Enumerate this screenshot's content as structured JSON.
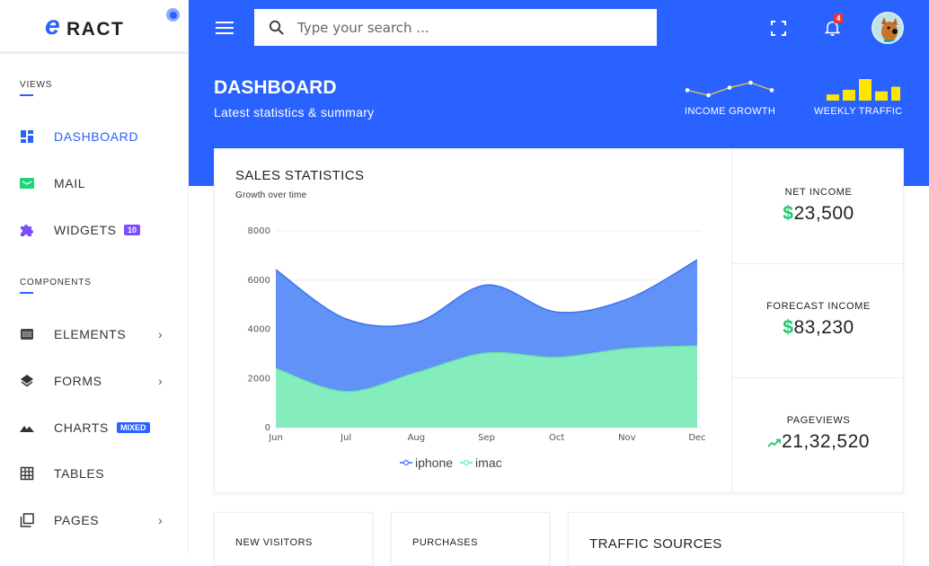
{
  "logo": {
    "mark": "e",
    "text": "RACT"
  },
  "sidebar": {
    "sections": [
      {
        "title": "VIEWS"
      },
      {
        "title": "COMPONENTS"
      }
    ],
    "items": [
      {
        "label": "DASHBOARD",
        "icon": "dashboard-icon",
        "active": true
      },
      {
        "label": "MAIL",
        "icon": "mail-icon"
      },
      {
        "label": "WIDGETS",
        "icon": "puzzle-icon",
        "badge": "10",
        "badge_color": "#7c4dff"
      },
      {
        "label": "ELEMENTS",
        "icon": "elements-icon",
        "chevron": "›"
      },
      {
        "label": "FORMS",
        "icon": "layers-icon",
        "chevron": "›"
      },
      {
        "label": "CHARTS",
        "icon": "landscape-icon",
        "badge": "MIXED",
        "badge_color": "#2962ff"
      },
      {
        "label": "TABLES",
        "icon": "grid-icon"
      },
      {
        "label": "PAGES",
        "icon": "pages-icon",
        "chevron": "›"
      }
    ]
  },
  "topbar": {
    "search_placeholder": "Type your search ...",
    "notifications_count": "4",
    "accent": "#2962ff"
  },
  "header": {
    "title": "DASHBOARD",
    "subtitle": "Latest statistics & summary",
    "income_growth_label": "INCOME GROWTH",
    "weekly_traffic_label": "WEEKLY TRAFFIC",
    "income_growth_values": [
      5,
      3,
      6,
      8,
      5
    ],
    "weekly_traffic_values": [
      2,
      3.5,
      7,
      3,
      4.5
    ]
  },
  "sales": {
    "title": "SALES STATISTICS",
    "subtitle": "Growth over time"
  },
  "chart_data": {
    "type": "area",
    "title": "SALES STATISTICS",
    "subtitle": "Growth over time",
    "categories": [
      "Jun",
      "Jul",
      "Aug",
      "Sep",
      "Oct",
      "Nov",
      "Dec"
    ],
    "series": [
      {
        "name": "iphone",
        "color": "#5b8ef7",
        "values": [
          6420,
          4420,
          4270,
          5800,
          4700,
          5220,
          6820
        ]
      },
      {
        "name": "imac",
        "color": "#86f0bb",
        "values": [
          2400,
          1460,
          2230,
          3030,
          2850,
          3210,
          3320
        ]
      }
    ],
    "yticks": [
      "0",
      "2000",
      "4000",
      "6000",
      "8000"
    ],
    "ylim": [
      0,
      8000
    ],
    "grid": true,
    "legend": "bottom-center"
  },
  "stats": [
    {
      "label": "NET INCOME",
      "prefix": "$",
      "value": "23,500"
    },
    {
      "label": "FORECAST INCOME",
      "prefix": "$",
      "value": "83,230"
    },
    {
      "label": "PAGEVIEWS",
      "prefix": "trend-up",
      "value": "21,32,520"
    }
  ],
  "bottom_cards": [
    {
      "title": "NEW VISITORS"
    },
    {
      "title": "PURCHASES"
    },
    {
      "title": "TRAFFIC SOURCES"
    }
  ]
}
